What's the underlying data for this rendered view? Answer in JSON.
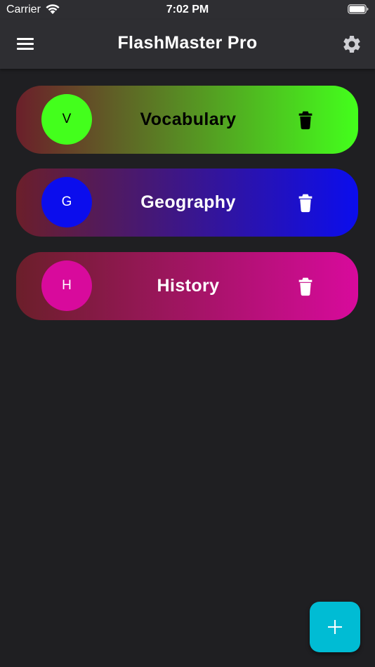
{
  "status_bar": {
    "carrier": "Carrier",
    "time": "7:02 PM"
  },
  "app_bar": {
    "title": "FlashMaster Pro"
  },
  "decks": [
    {
      "name": "Vocabulary",
      "initial": "V",
      "color": "#43ff1c",
      "text_color": "#000000"
    },
    {
      "name": "Geography",
      "initial": "G",
      "color": "#0b0ded",
      "text_color": "#ffffff"
    },
    {
      "name": "History",
      "initial": "H",
      "color": "#d80a9c",
      "text_color": "#ffffff"
    }
  ],
  "icons": {
    "menu": "hamburger-menu-icon",
    "settings": "gear-icon",
    "delete": "trash-icon",
    "add": "plus-icon"
  },
  "colors": {
    "background": "#1f1f22",
    "app_bar": "#2e2e32",
    "fab": "#00bcd4",
    "card_start": "#6b1f2a"
  }
}
